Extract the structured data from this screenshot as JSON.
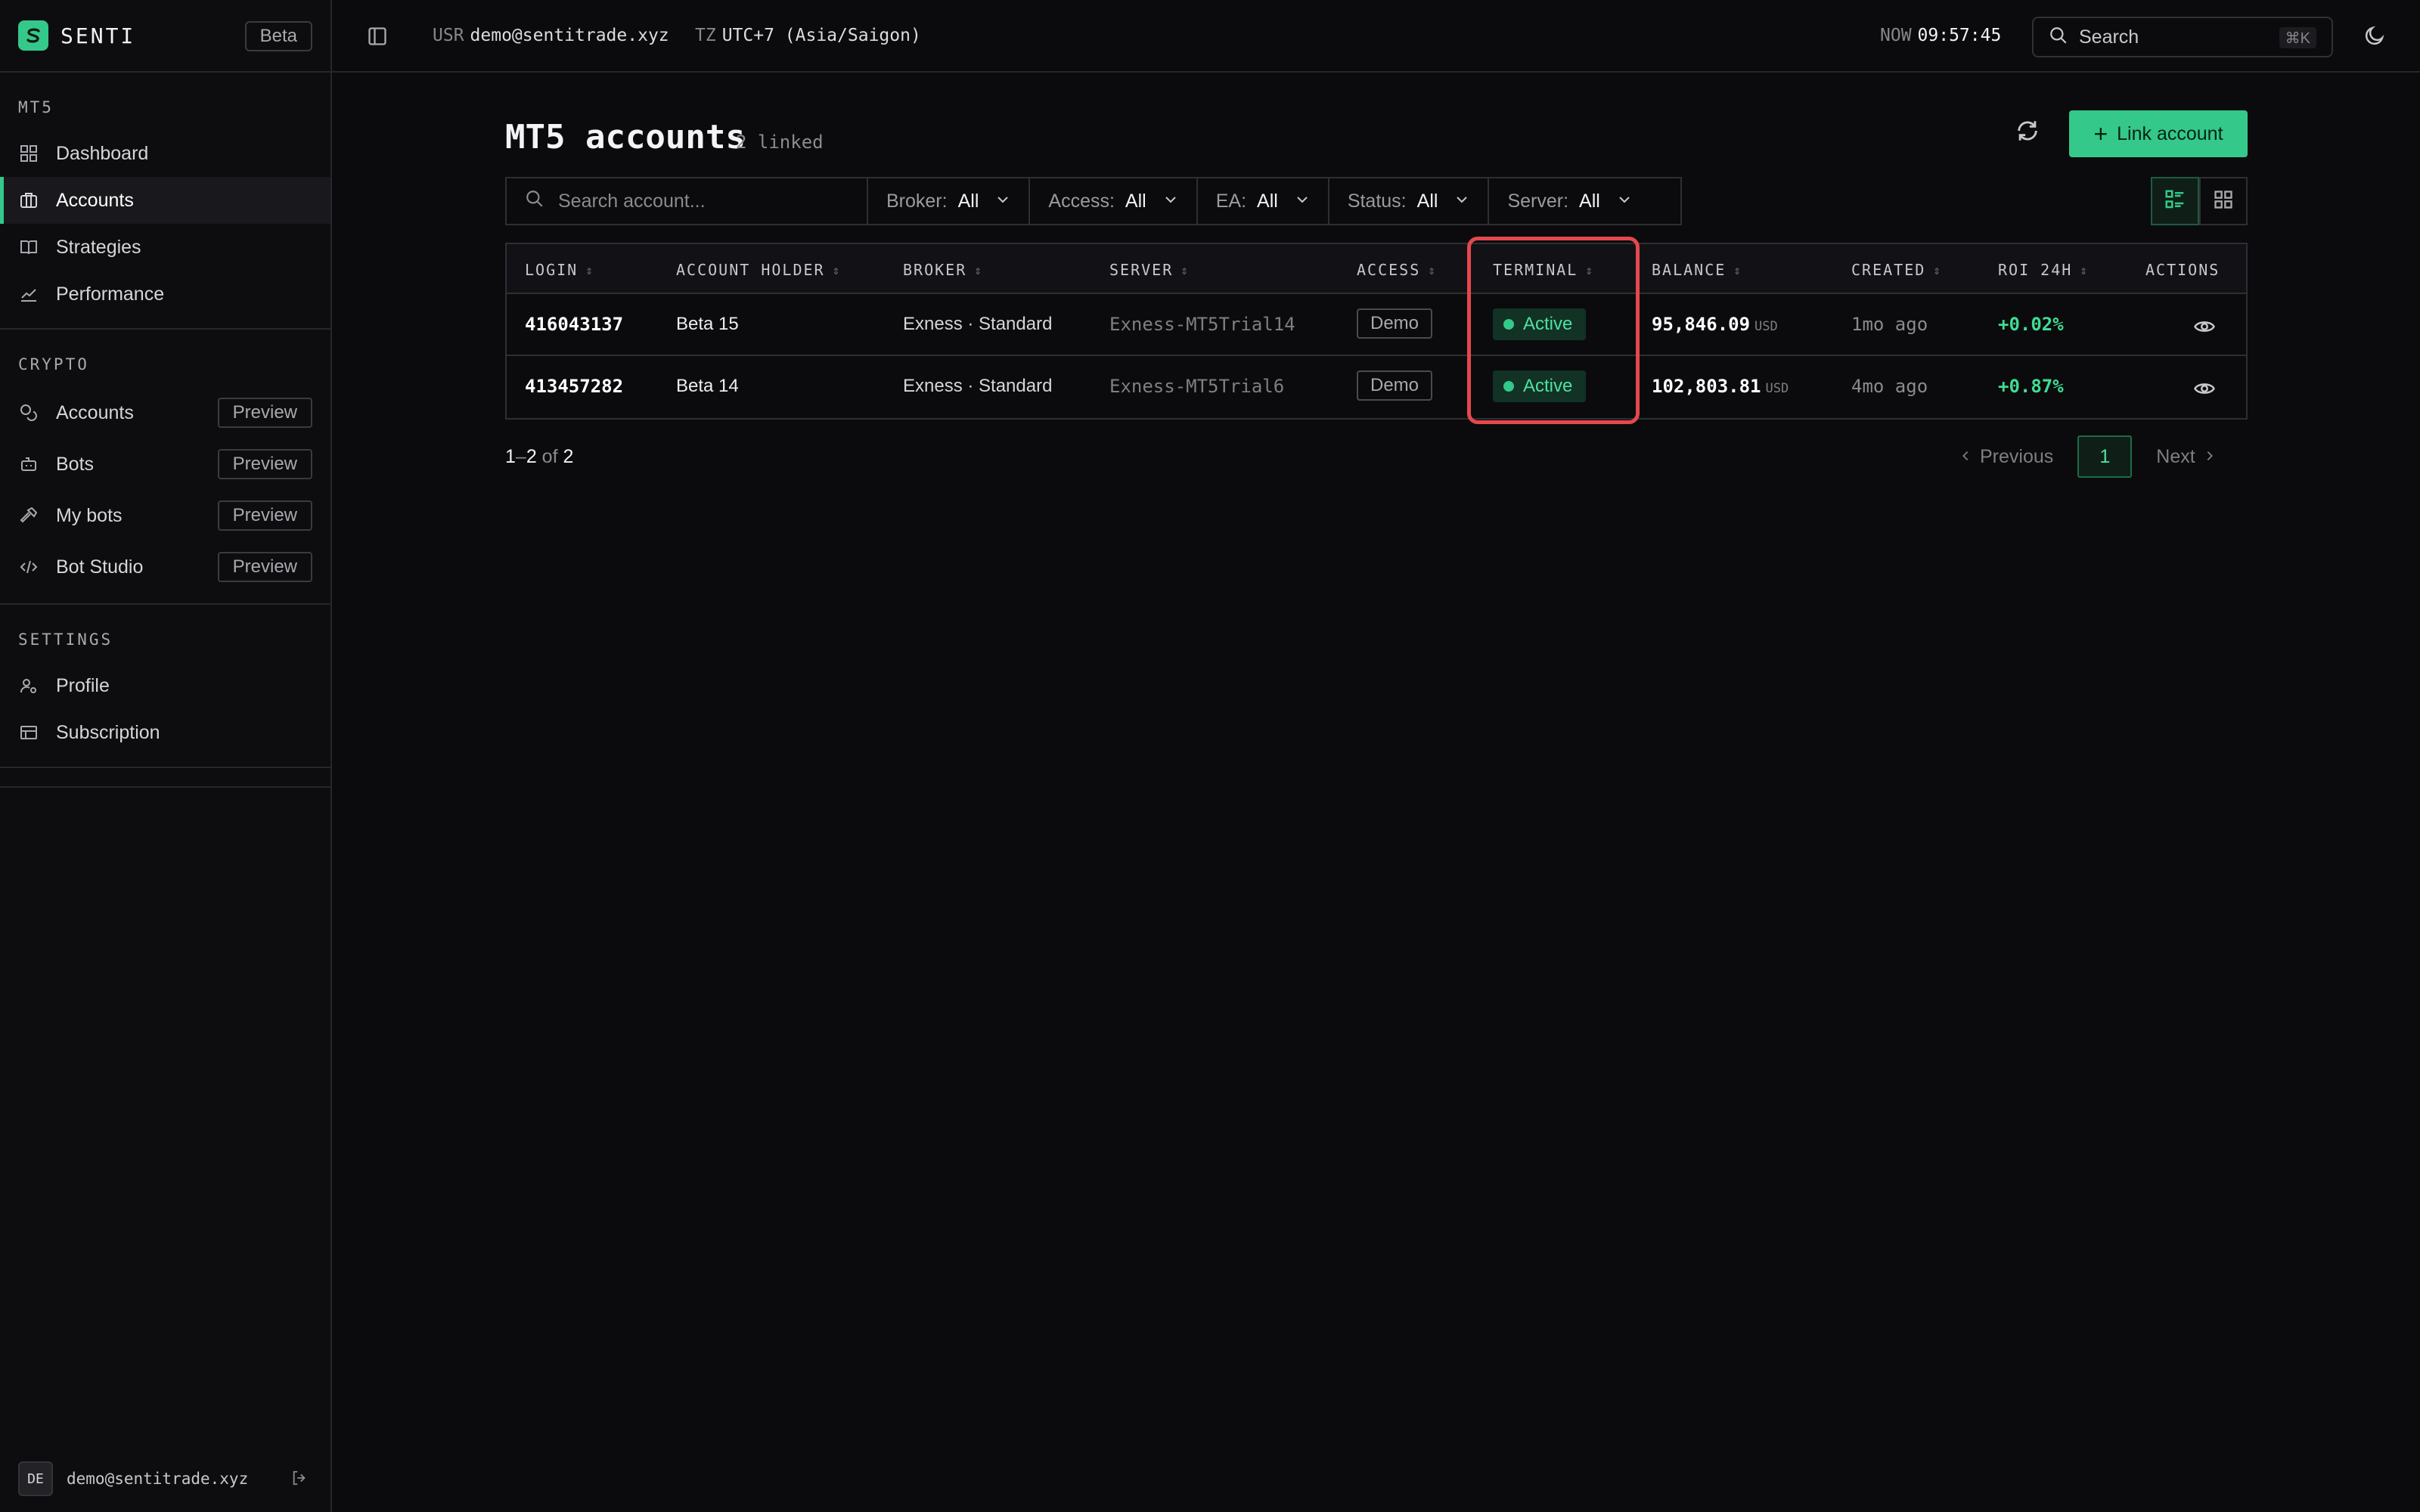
{
  "app": {
    "name": "SENTI",
    "badge": "Beta"
  },
  "sidebar": {
    "sections": [
      {
        "label": "MT5",
        "items": [
          {
            "label": "Dashboard",
            "icon": "dashboard-grid-icon"
          },
          {
            "label": "Accounts",
            "icon": "accounts-icon",
            "active": true
          },
          {
            "label": "Strategies",
            "icon": "book-icon"
          },
          {
            "label": "Performance",
            "icon": "chart-line-icon"
          }
        ]
      },
      {
        "label": "CRYPTO",
        "items": [
          {
            "label": "Accounts",
            "icon": "coins-icon",
            "tag": "Preview"
          },
          {
            "label": "Bots",
            "icon": "bot-icon",
            "tag": "Preview"
          },
          {
            "label": "My bots",
            "icon": "hammer-icon",
            "tag": "Preview"
          },
          {
            "label": "Bot Studio",
            "icon": "code-icon",
            "tag": "Preview"
          }
        ]
      },
      {
        "label": "SETTINGS",
        "items": [
          {
            "label": "Profile",
            "icon": "user-cog-icon"
          },
          {
            "label": "Subscription",
            "icon": "card-icon"
          }
        ]
      }
    ],
    "footer": {
      "avatar": "DE",
      "email": "demo@sentitrade.xyz"
    }
  },
  "topbar": {
    "user_key": "USR",
    "user": "demo@sentitrade.xyz",
    "tz_key": "TZ",
    "tz": "UTC+7 (Asia/Saigon)",
    "now_key": "NOW",
    "now": "09:57:45",
    "search_label": "Search",
    "search_kbd": "⌘K"
  },
  "page": {
    "title": "MT5 accounts",
    "subtitle": "2 linked",
    "link_button": "Link account"
  },
  "filters": {
    "search_placeholder": "Search account...",
    "items": [
      {
        "label": "Broker:",
        "value": "All"
      },
      {
        "label": "Access:",
        "value": "All"
      },
      {
        "label": "EA:",
        "value": "All"
      },
      {
        "label": "Status:",
        "value": "All"
      },
      {
        "label": "Server:",
        "value": "All"
      }
    ]
  },
  "table": {
    "columns": [
      "LOGIN",
      "ACCOUNT HOLDER",
      "BROKER",
      "SERVER",
      "ACCESS",
      "TERMINAL",
      "BALANCE",
      "CREATED",
      "ROI 24H",
      "ACTIONS"
    ],
    "rows": [
      {
        "login": "416043137",
        "holder": "Beta 15",
        "broker": "Exness · Standard",
        "server": "Exness-MT5Trial14",
        "access": "Demo",
        "terminal": "Active",
        "balance": "95,846.09",
        "currency": "USD",
        "created": "1mo ago",
        "roi": "+0.02%"
      },
      {
        "login": "413457282",
        "holder": "Beta 14",
        "broker": "Exness · Standard",
        "server": "Exness-MT5Trial6",
        "access": "Demo",
        "terminal": "Active",
        "balance": "102,803.81",
        "currency": "USD",
        "created": "4mo ago",
        "roi": "+0.87%"
      }
    ]
  },
  "pagination": {
    "range_start": "1",
    "range_sep": "–",
    "range_end": "2",
    "of_label": "of",
    "total": "2",
    "prev": "Previous",
    "page": "1",
    "next": "Next"
  },
  "colors": {
    "accent": "#34c88a",
    "highlight": "#e5484d",
    "background": "#0b0b0d"
  }
}
